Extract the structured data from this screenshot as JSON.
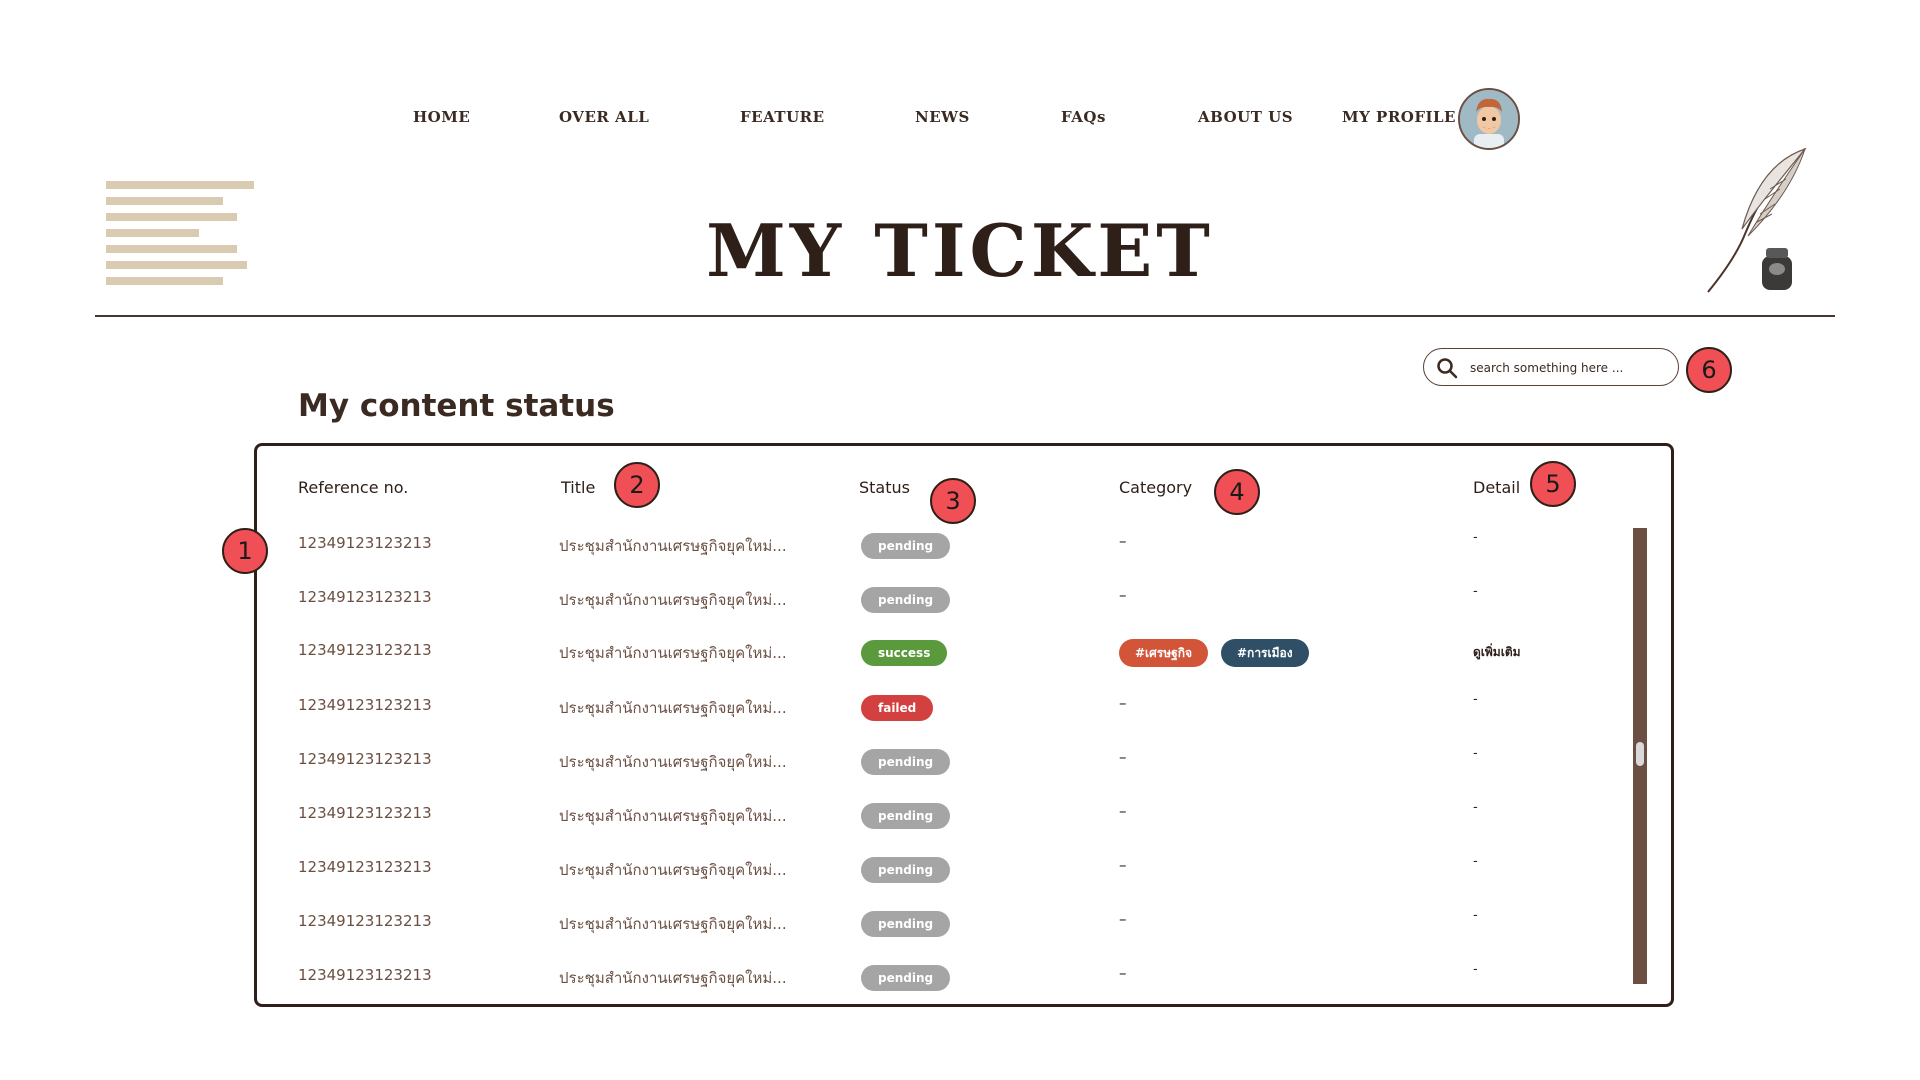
{
  "nav": {
    "items": [
      "HOME",
      "OVER ALL",
      "FEATURE",
      "NEWS",
      "FAQs",
      "ABOUT US",
      "MY PROFILE"
    ]
  },
  "header": {
    "title": "MY TICKET"
  },
  "search": {
    "placeholder": "search something here ..."
  },
  "section": {
    "title": "My content status"
  },
  "table": {
    "columns": [
      "Reference no.",
      "Title",
      "Status",
      "Category",
      "Detail"
    ],
    "rows": [
      {
        "ref": "12349123123213",
        "title": "ประชุมสำนักงานเศรษฐกิจยุคใหม่...",
        "status": "pending",
        "category": "–",
        "detail": "-"
      },
      {
        "ref": "12349123123213",
        "title": "ประชุมสำนักงานเศรษฐกิจยุคใหม่...",
        "status": "pending",
        "category": "–",
        "detail": "-"
      },
      {
        "ref": "12349123123213",
        "title": "ประชุมสำนักงานเศรษฐกิจยุคใหม่...",
        "status": "success",
        "tags": [
          "#เศรษฐกิจ",
          "#การเมือง"
        ],
        "detail": "ดูเพิ่มเติม"
      },
      {
        "ref": "12349123123213",
        "title": "ประชุมสำนักงานเศรษฐกิจยุคใหม่...",
        "status": "failed",
        "category": "–",
        "detail": "-"
      },
      {
        "ref": "12349123123213",
        "title": "ประชุมสำนักงานเศรษฐกิจยุคใหม่...",
        "status": "pending",
        "category": "–",
        "detail": "-"
      },
      {
        "ref": "12349123123213",
        "title": "ประชุมสำนักงานเศรษฐกิจยุคใหม่...",
        "status": "pending",
        "category": "–",
        "detail": "-"
      },
      {
        "ref": "12349123123213",
        "title": "ประชุมสำนักงานเศรษฐกิจยุคใหม่...",
        "status": "pending",
        "category": "–",
        "detail": "-"
      },
      {
        "ref": "12349123123213",
        "title": "ประชุมสำนักงานเศรษฐกิจยุคใหม่...",
        "status": "pending",
        "category": "–",
        "detail": "-"
      },
      {
        "ref": "12349123123213",
        "title": "ประชุมสำนักงานเศรษฐกิจยุคใหม่...",
        "status": "pending",
        "category": "–",
        "detail": "-"
      }
    ]
  },
  "colors": {
    "pending": "#a5a5a5",
    "success": "#5a9a3c",
    "failed": "#d2403f",
    "tag_economy": "#d2553a",
    "tag_politics": "#2f4f66",
    "marker": "#f05055",
    "brown": "#6b4f43"
  },
  "markers": [
    "1",
    "2",
    "3",
    "4",
    "5",
    "6"
  ],
  "icons": {
    "avatar": "avatar",
    "menu": "menu-lines-icon",
    "quill": "quill-inkwell-icon",
    "search": "search-icon"
  }
}
